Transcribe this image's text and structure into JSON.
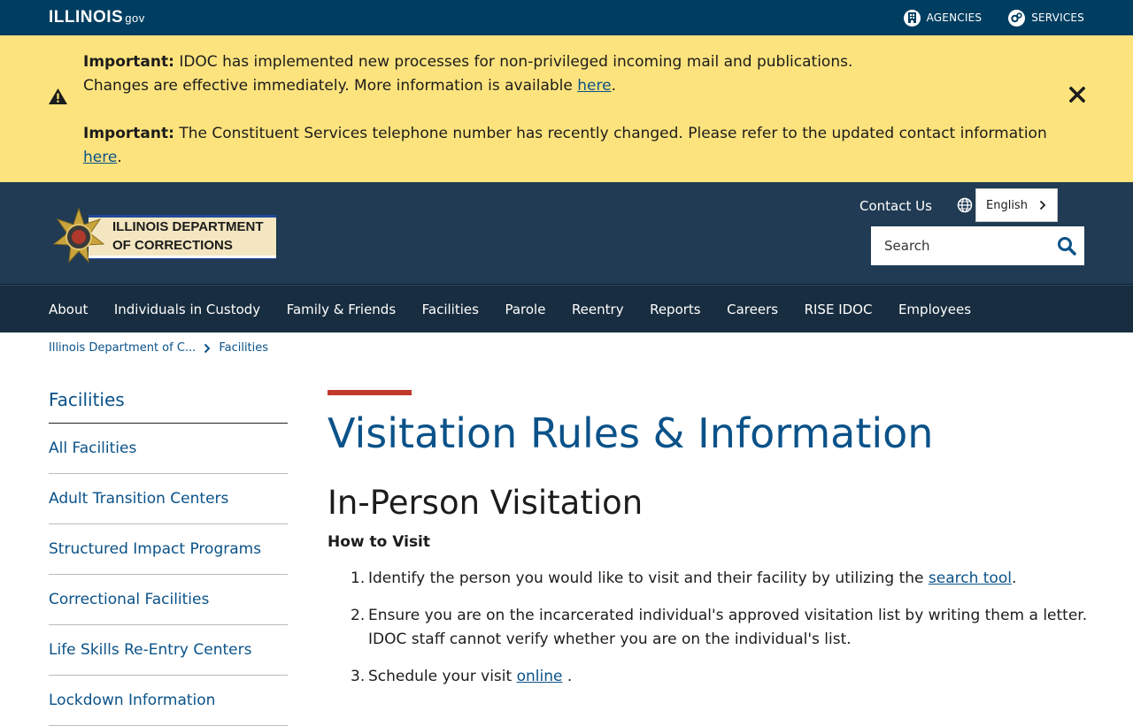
{
  "topbar": {
    "logo_text": "ILLINOIS",
    "logo_suffix": "gov",
    "links": [
      {
        "label": "AGENCIES",
        "icon": "building-icon"
      },
      {
        "label": "SERVICES",
        "icon": "gears-icon"
      }
    ]
  },
  "alert": {
    "p1_bold": "Important:",
    "p1_text": "IDOC has implemented new processes for non-privileged incoming mail and publications.",
    "p1_line2": "Changes are effective immediately. More information is available",
    "p1_link": "here",
    "p2_bold": "Important:",
    "p2_text": "The Constituent Services telephone number has recently changed. Please refer to the updated contact information",
    "p2_link": "here"
  },
  "header": {
    "logo_line1": "ILLINOIS DEPARTMENT",
    "logo_line2": "OF CORRECTIONS",
    "contact_label": "Contact Us",
    "language_value": "English",
    "search_placeholder": "Search"
  },
  "nav": {
    "items": [
      "About",
      "Individuals in Custody",
      "Family & Friends",
      "Facilities",
      "Parole",
      "Reentry",
      "Reports",
      "Careers",
      "RISE IDOC",
      "Employees"
    ]
  },
  "breadcrumb": {
    "items": [
      "Illinois Department of C...",
      "Facilities"
    ]
  },
  "sidebar": {
    "title": "Facilities",
    "items": [
      "All Facilities",
      "Adult Transition Centers",
      "Structured Impact Programs",
      "Correctional Facilities",
      "Life Skills Re-Entry Centers",
      "Lockdown Information"
    ]
  },
  "main": {
    "title": "Visitation Rules & Information",
    "section_title": "In-Person Visitation",
    "subsection_title": "How to Visit",
    "steps": [
      {
        "num": "1.",
        "text": "Identify the person you would like to visit and their facility by utilizing the",
        "link": "search tool",
        "after": "."
      },
      {
        "num": "2.",
        "text": "Ensure you are on the incarcerated individual's approved visitation list by writing them a letter. IDOC staff cannot verify whether you are on the individual's list.",
        "link": "",
        "after": ""
      },
      {
        "num": "3.",
        "text": "Schedule your visit",
        "link": "online",
        "after": " ."
      }
    ]
  },
  "colors": {
    "topbar": "#003e61",
    "alert": "#fde37d",
    "header": "#203b53",
    "nav": "#182d3f",
    "link": "#0a5289",
    "accent": "#c0392b"
  }
}
